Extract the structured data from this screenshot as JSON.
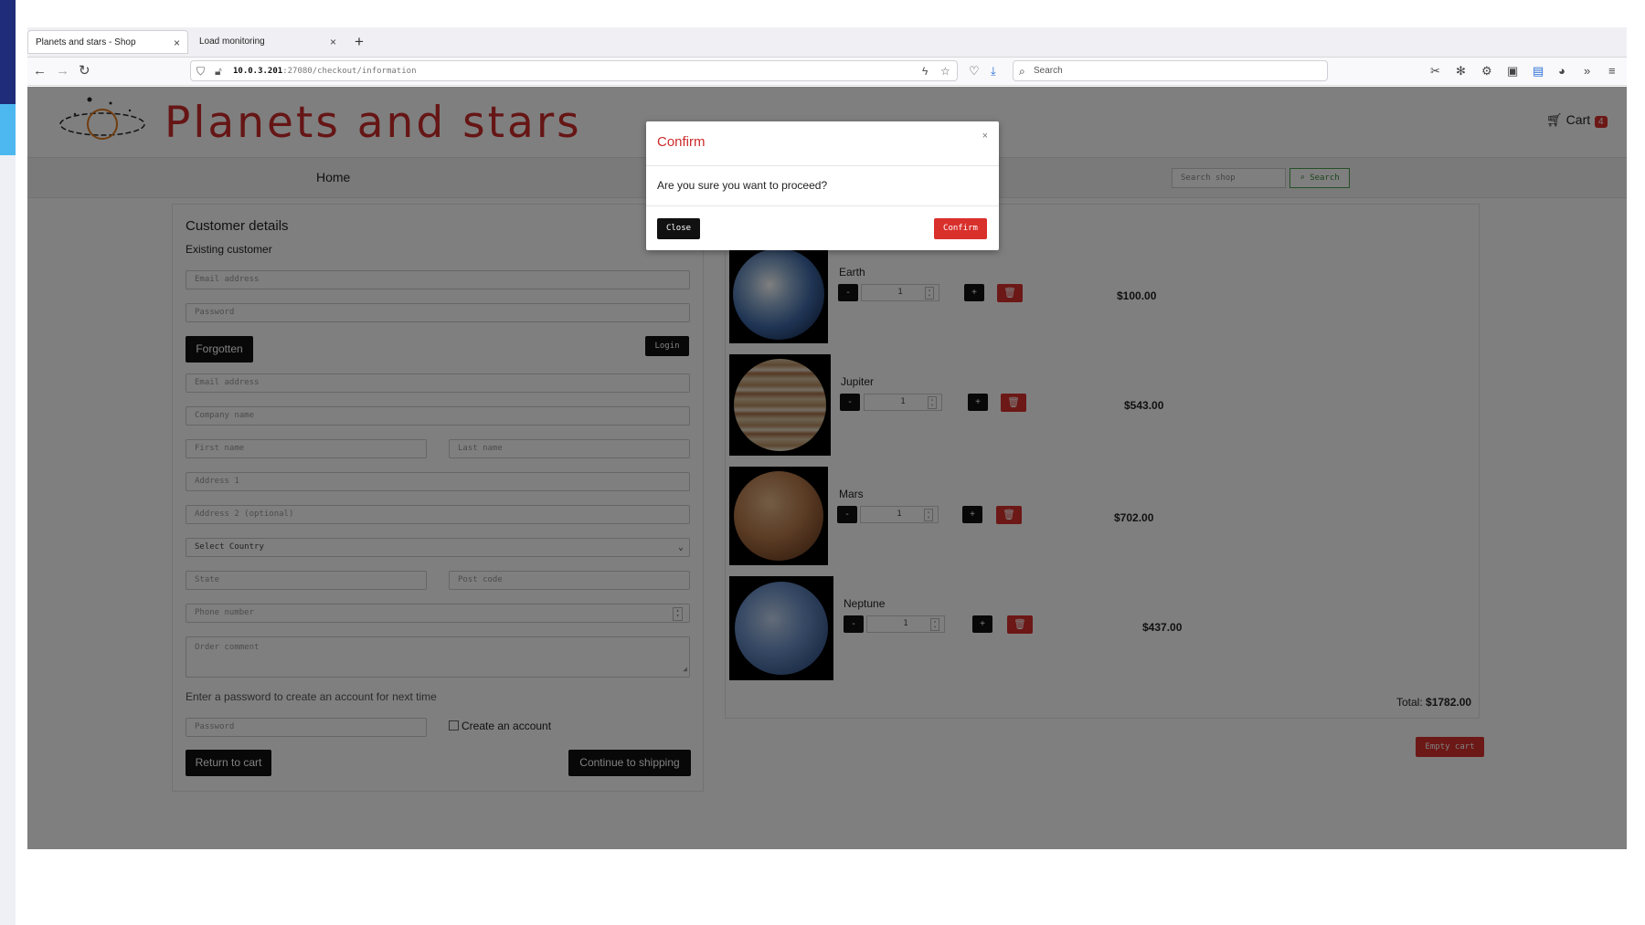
{
  "browser": {
    "tabs": [
      {
        "title": "Planets and stars - Shop",
        "close": "×"
      },
      {
        "title": "Load monitoring",
        "close": "×"
      }
    ],
    "new_tab": "+",
    "url": {
      "host": "10.0.3.201",
      "rest": ":27080/checkout/information"
    },
    "search_placeholder": "Search"
  },
  "site": {
    "title": "Planets and stars",
    "cart_label": "Cart",
    "cart_count": "4",
    "menu_home": "Home",
    "search_placeholder": "Search shop",
    "search_button": "Search"
  },
  "customer": {
    "heading": "Customer details",
    "existing": "Existing customer",
    "login_email_placeholder": "Email address",
    "login_password_placeholder": "Password",
    "forgotten_button": "Forgotten",
    "login_button": "Login",
    "email_placeholder": "Email address",
    "company_placeholder": "Company name",
    "first_name_placeholder": "First name",
    "last_name_placeholder": "Last name",
    "address1_placeholder": "Address 1",
    "address2_placeholder": "Address 2 (optional)",
    "country_select": "Select Country",
    "state_placeholder": "State",
    "postcode_placeholder": "Post code",
    "phone_placeholder": "Phone number",
    "comment_placeholder": "Order comment",
    "create_note": "Enter a password to create an account for next time",
    "new_password_placeholder": "Password",
    "create_account_label": "Create an account",
    "return_button": "Return to cart",
    "continue_button": "Continue to shipping"
  },
  "cart": {
    "items": [
      {
        "name": "Earth",
        "qty": "1",
        "price": "$100.00"
      },
      {
        "name": "Jupiter",
        "qty": "1",
        "price": "$543.00"
      },
      {
        "name": "Mars",
        "qty": "1",
        "price": "$702.00"
      },
      {
        "name": "Neptune",
        "qty": "1",
        "price": "$437.00"
      }
    ],
    "minus": "-",
    "plus": "+",
    "total_label": "Total:",
    "total_value": "$1782.00",
    "empty_button": "Empty cart"
  },
  "modal": {
    "title": "Confirm",
    "close_x": "×",
    "body": "Are you sure you want to proceed?",
    "close_button": "Close",
    "confirm_button": "Confirm"
  },
  "colors": {
    "brand_red": "#cc2a2a",
    "button_red": "#d9302c",
    "dark": "#111111"
  }
}
